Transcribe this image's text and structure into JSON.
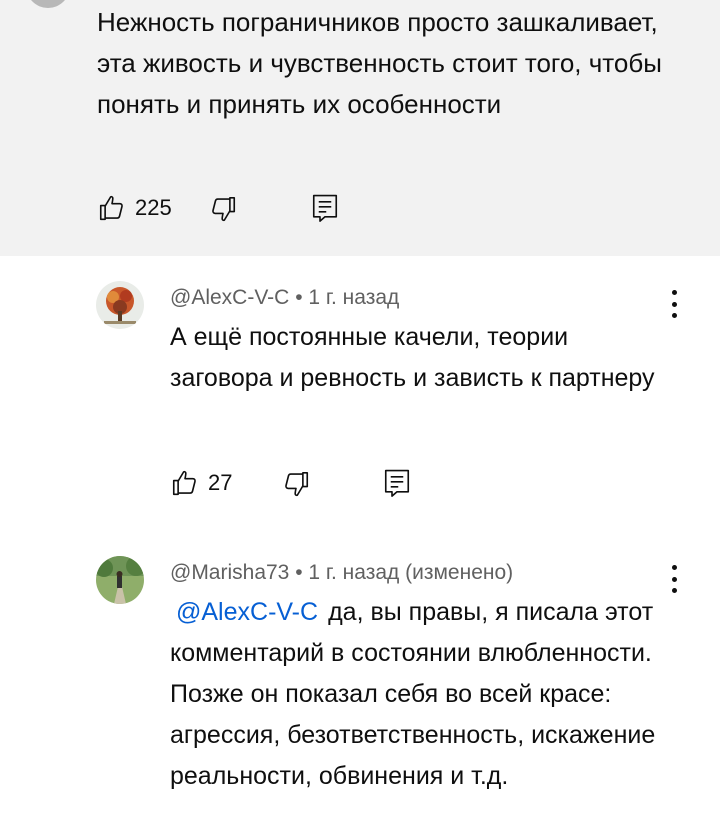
{
  "parent_comment": {
    "text": "Нежность пограничников просто зашкаливает, эта живость и чувственность стоит того, чтобы понять и принять их особенности",
    "likes": "225"
  },
  "replies": [
    {
      "author": "@AlexC-V-C",
      "time": "1 г. назад",
      "edited": "",
      "mention": "",
      "text": "А ещё постоянные качели, теории заговора и ревность и зависть к партнеру",
      "likes": "27"
    },
    {
      "author": "@Marisha73",
      "time": "1 г. назад",
      "edited": "(изменено)",
      "mention": "@AlexC-V-C",
      "text": "да, вы правы, я писала этот комментарий в состоянии влюбленности. Позже он показал себя во всей красе: агрессия, безответственность, искажение реальности, обвинения и т.д."
    }
  ],
  "icons": {
    "like": "thumb-up-icon",
    "dislike": "thumb-down-icon",
    "reply": "reply-comment-icon",
    "more": "more-vertical-icon"
  },
  "colors": {
    "highlight_bg": "#f2f2f2",
    "mention": "#065fd4",
    "meta": "#606060"
  }
}
